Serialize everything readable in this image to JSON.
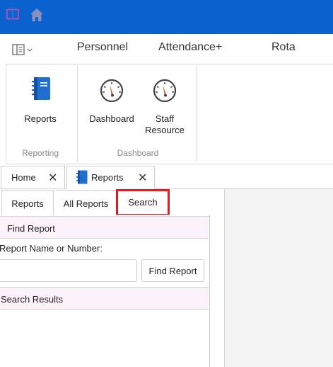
{
  "colors": {
    "title_bar": "#0a62cf",
    "highlight": "#e01c23",
    "section_header_bg": "#faf2f8"
  },
  "title_bar": {
    "icons": [
      "sidebar-toggle-icon",
      "home-icon"
    ]
  },
  "menu": {
    "items": [
      "Personnel",
      "Attendance+",
      "Rota"
    ]
  },
  "ribbon": {
    "reporting": {
      "button_label": "Reports",
      "group_label": "Reporting"
    },
    "dashboard": {
      "dashboard_label": "Dashboard",
      "staff_label_line1": "Staff",
      "staff_label_line2": "Resource",
      "group_label": "Dashboard"
    }
  },
  "doc_tabs": [
    {
      "label": "Home",
      "close": "✕"
    },
    {
      "label": "Reports",
      "close": "✕"
    }
  ],
  "sub_tabs": [
    "Reports",
    "All Reports",
    "Search"
  ],
  "find_section": {
    "header": "Find Report",
    "field_label": "Report Name or Number:",
    "input_value": "",
    "button_label": "Find Report"
  },
  "results_section": {
    "header": "Search Results"
  }
}
